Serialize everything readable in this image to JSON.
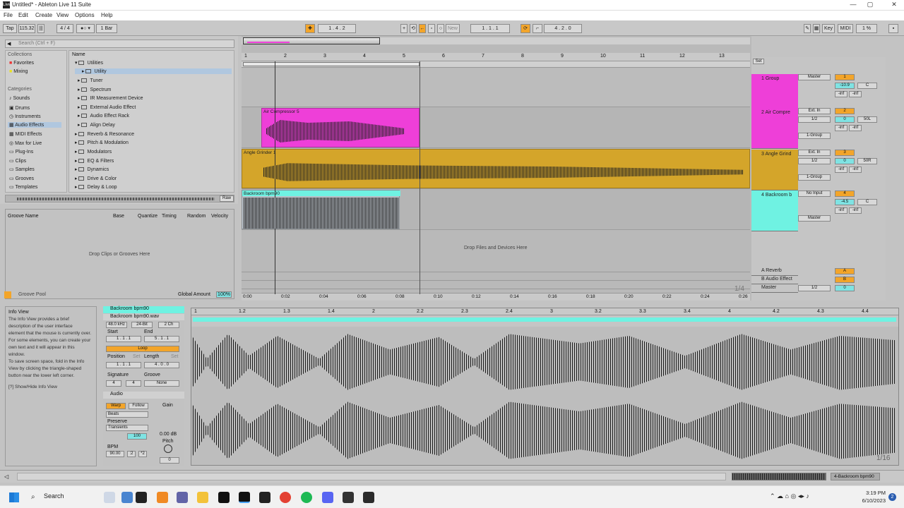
{
  "window": {
    "title": "Untitled* - Ableton Live 11 Suite",
    "logo": "Live",
    "min": "—",
    "max": "▢",
    "close": "✕"
  },
  "menu": [
    "File",
    "Edit",
    "Create",
    "View",
    "Options",
    "Help"
  ],
  "transport": {
    "tap": "Tap",
    "tempo": "115.32",
    "sig": "4 / 4",
    "loop_len": "1 Bar",
    "position": "1 .  4 .  2",
    "loop_start": "1 .  1 .  1",
    "loop_end": "4 .  2 .  0",
    "new": "New",
    "key": "Key",
    "midi": "MIDI",
    "cpu": "1 %"
  },
  "browser": {
    "search_placeholder": "Search (Ctrl + F)",
    "collections_header": "Collections",
    "collections": [
      "Favorites",
      "Mixing"
    ],
    "categories_header": "Categories",
    "categories": [
      "Sounds",
      "Drums",
      "Instruments",
      "Audio Effects",
      "MIDI Effects",
      "Max for Live",
      "Plug-Ins",
      "Clips",
      "Samples",
      "Grooves",
      "Templates"
    ],
    "name_header": "Name",
    "items": [
      "Utilities",
      "Utility",
      "Tuner",
      "Spectrum",
      "IR Measurement Device",
      "External Audio Effect",
      "Audio Effect Rack",
      "Align Delay",
      "Reverb & Resonance",
      "Pitch & Modulation",
      "Modulators",
      "EQ & Filters",
      "Dynamics",
      "Drive & Color",
      "Delay & Loop"
    ],
    "raw": "Raw"
  },
  "groove": {
    "cols": [
      "Groove Name",
      "Base",
      "Quantize",
      "Timing",
      "Random",
      "Velocity"
    ],
    "drop": "Drop Clips or Grooves Here",
    "pool": "Groove Pool",
    "global": "Global Amount",
    "global_val": "100%"
  },
  "info": {
    "title": "Info View",
    "body": [
      "The Info View provides a brief",
      "description of the user interface",
      "element that the mouse is currently over.",
      "For some elements, you can create your",
      "own text and it will appear in this",
      "window.",
      "To save screen space, fold in the Info",
      "View by clicking the triangle-shaped",
      "button near the lower left corner."
    ],
    "toggle": "[?] Show/Hide Info View"
  },
  "ruler": [
    "1",
    "2",
    "3",
    "4",
    "5",
    "6",
    "7",
    "8",
    "9",
    "10",
    "11",
    "12",
    "13"
  ],
  "time_ruler": [
    "0:00",
    "0:02",
    "0:04",
    "0:06",
    "0:08",
    "0:10",
    "0:12",
    "0:14",
    "0:16",
    "0:18",
    "0:20",
    "0:22",
    "0:24",
    "0:26"
  ],
  "zoom": "1/4",
  "clips": {
    "air": "Air Compressor 5",
    "angle": "Angle Grinder 1",
    "backroom": "Backroom bpm90"
  },
  "drop_here": "Drop Files and Devices Here",
  "set": "Set",
  "tracks": [
    {
      "name": "1 Group",
      "color": "#ee3fd8",
      "route": "Master",
      "num": "1",
      "vol": "-10.9",
      "pan": "C"
    },
    {
      "name": "2 Air Compre",
      "color": "#ee3fd8",
      "route": "Ext. In",
      "sub": "1/2",
      "out": "1-Group",
      "num": "2",
      "vol": "0",
      "pan": "50L"
    },
    {
      "name": "3 Angle Grind",
      "color": "#d4a52a",
      "route": "Ext. In",
      "sub": "1/2",
      "out": "1-Group",
      "num": "3",
      "vol": "0",
      "pan": "50R"
    },
    {
      "name": "4 Backroom b",
      "color": "#6ff2e2",
      "route": "No Input",
      "out": "Master",
      "num": "4",
      "vol": "-4.5",
      "pan": "C"
    }
  ],
  "returns": [
    {
      "name": "A Reverb",
      "letter": "A"
    },
    {
      "name": "B Audio Effect",
      "letter": "B"
    },
    {
      "name": "Master",
      "route": "1/2",
      "num": "0"
    }
  ],
  "inf": "-inf",
  "clipview": {
    "name": "Backroom bpm90",
    "file": "Backroom bpm90.wav",
    "rate": "48.0 kHz",
    "bits": "24-Bit",
    "ch": "2 Ch",
    "start_lbl": "Start",
    "end_lbl": "End",
    "start": "1 .  1 .  1",
    "end": "5 .  1 .  1",
    "loop": "Loop",
    "position_lbl": "Position",
    "length_lbl": "Length",
    "set": "Set",
    "position": "1 .  1 .  1",
    "length": "4 .  0 .  0",
    "signature_lbl": "Signature",
    "groove_lbl": "Groove",
    "sig1": "4",
    "sig2": "4",
    "groove": "None",
    "audio": "Audio",
    "warp": "Warp",
    "follow": "Follow",
    "beats": "Beats",
    "gain": "Gain",
    "preserve": "Preserve",
    "transients": "Transients",
    "value100": "100",
    "gain_val": "0.00 dB",
    "pitch": "Pitch",
    "bpm_lbl": "BPM",
    "bpm": "90.00",
    "half": ":2",
    "dbl": "*2",
    "pitch_val": "0"
  },
  "sample_ruler": [
    "1",
    "1.2",
    "1.3",
    "1.4",
    "2",
    "2.2",
    "2.3",
    "2.4",
    "3",
    "3.2",
    "3.3",
    "3.4",
    "4",
    "4.2",
    "4.3",
    "4.4"
  ],
  "sample_zoom": "1/16",
  "status_track": "4-Backroom bpm90",
  "taskbar": {
    "search": "Search",
    "time": "3:19 PM",
    "date": "6/10/2023",
    "badge": "2"
  }
}
